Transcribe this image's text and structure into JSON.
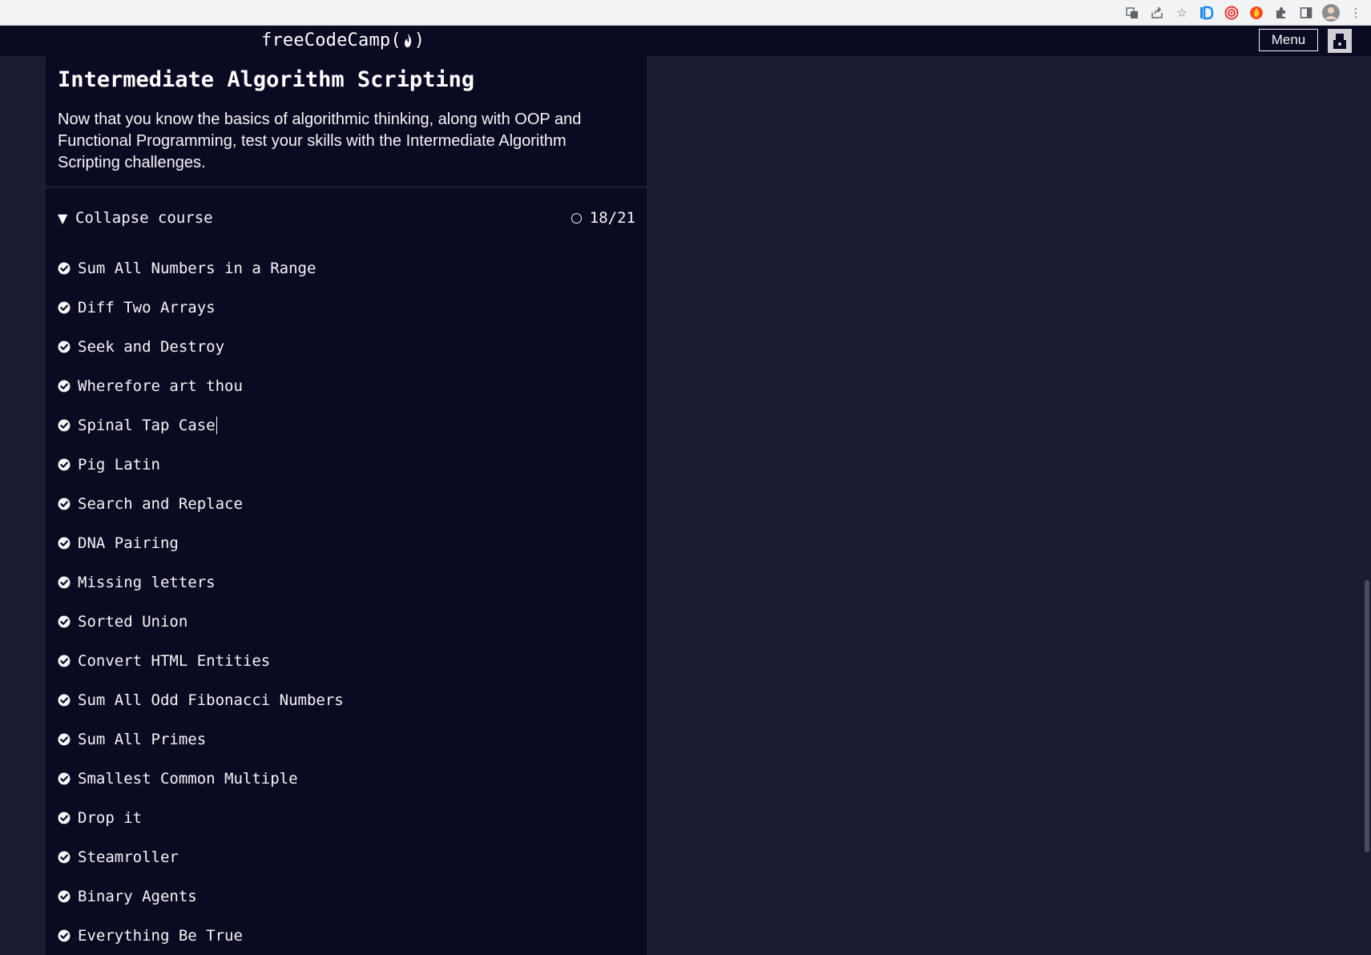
{
  "browser": {
    "icons": [
      "translate-icon",
      "share-icon",
      "star-icon",
      "extension-d-icon",
      "extension-target-icon",
      "extension-fire-icon",
      "puzzle-icon",
      "sidepanel-icon",
      "profile-avatar-icon",
      "more-icon"
    ]
  },
  "nav": {
    "logo_left": "freeCodeCamp(",
    "logo_right": ")",
    "menu_label": "Menu"
  },
  "block": {
    "title": "Intermediate Algorithm Scripting",
    "description": "Now that you know the basics of algorithmic thinking, along with OOP and Functional Programming, test your skills with the Intermediate Algorithm Scripting challenges.",
    "collapse_label": "Collapse course",
    "progress_label": "18/21",
    "completed": 18,
    "total": 21
  },
  "challenges": [
    {
      "title": "Sum All Numbers in a Range",
      "completed": true
    },
    {
      "title": "Diff Two Arrays",
      "completed": true
    },
    {
      "title": "Seek and Destroy",
      "completed": true
    },
    {
      "title": "Wherefore art thou",
      "completed": true
    },
    {
      "title": "Spinal Tap Case",
      "completed": true
    },
    {
      "title": "Pig Latin",
      "completed": true
    },
    {
      "title": "Search and Replace",
      "completed": true
    },
    {
      "title": "DNA Pairing",
      "completed": true
    },
    {
      "title": "Missing letters",
      "completed": true
    },
    {
      "title": "Sorted Union",
      "completed": true
    },
    {
      "title": "Convert HTML Entities",
      "completed": true
    },
    {
      "title": "Sum All Odd Fibonacci Numbers",
      "completed": true
    },
    {
      "title": "Sum All Primes",
      "completed": true
    },
    {
      "title": "Smallest Common Multiple",
      "completed": true
    },
    {
      "title": "Drop it",
      "completed": true
    },
    {
      "title": "Steamroller",
      "completed": true
    },
    {
      "title": "Binary Agents",
      "completed": true
    },
    {
      "title": "Everything Be True",
      "completed": true
    }
  ],
  "colors": {
    "page_bg": "#1b1b32",
    "panel_bg": "#0a0a23",
    "text": "#f5f6f7"
  }
}
